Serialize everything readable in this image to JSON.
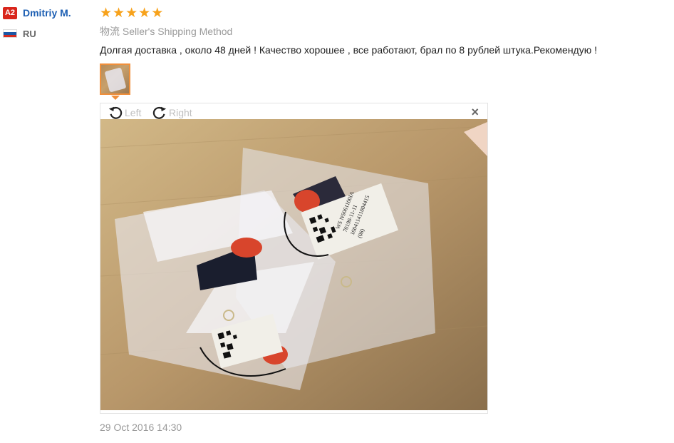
{
  "user": {
    "level_badge": "A2",
    "name": "Dmitriy M.",
    "country": "RU",
    "flag_colors": [
      "#ffffff",
      "#1c57a5",
      "#d52b1e"
    ]
  },
  "review": {
    "rating": 5,
    "star_color": "#f7a21b",
    "shipping_prefix": "物流",
    "shipping_method": "Seller's Shipping Method",
    "text": "Долгая доставка , около 48 дней ! Качество хорошее , все работают, брал по 8 рублей штука.Рекомендую !",
    "timestamp": "29 Oct 2016 14:30"
  },
  "viewer": {
    "rotate_left_label": "Left",
    "rotate_right_label": "Right",
    "close_label": "×",
    "label_lines": [
      "WS NS061100IA",
      "70190-11-11",
      "160411411004415",
      "(08)"
    ]
  }
}
